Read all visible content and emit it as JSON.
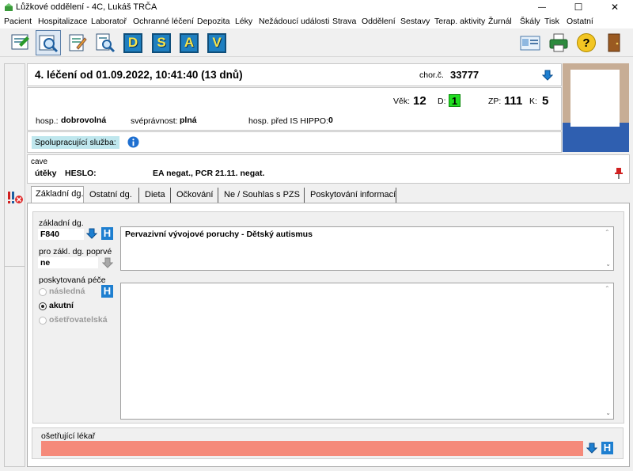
{
  "window": {
    "title": "Lůžkové oddělení - 4C, Lukáš TRČA",
    "minimize": "—",
    "maximize": "☐",
    "close": "✕"
  },
  "menu": [
    "Pacient",
    "Hospitalizace",
    "Laboratoř",
    "Ochranné léčení",
    "Depozita",
    "Léky",
    "Nežádoucí události",
    "Strava",
    "Oddělení",
    "Sestavy",
    "Terap. aktivity",
    "Žurnál",
    "Škály",
    "Tisk",
    "Ostatní"
  ],
  "toolbar": {
    "letters": [
      "D",
      "S",
      "A",
      "V"
    ],
    "help": "?"
  },
  "header": {
    "treatment": "4. léčení od 01.09.2022, 10:41:40 (13 dnů)",
    "chor_label": "chor.č.",
    "chor_value": "33777",
    "vek_label": "Věk:",
    "vek_value": "12",
    "d_label": "D:",
    "d_value": "1",
    "zp_label": "ZP:",
    "zp_value": "111",
    "k_label": "K:",
    "k_value": "5",
    "hosp_label": "hosp.:",
    "hosp_value": "dobrovolná",
    "svepr_label": "svéprávnost:",
    "svepr_value": "plná",
    "hippo_label": "hosp. před IS HIPPO:",
    "hippo_value": "0",
    "sluzba_label": "Spolupracující služba:"
  },
  "cave": {
    "label": "cave",
    "utek": "útěky",
    "heslo": "HESLO:",
    "text": "EA negat., PCR 21.11. negat."
  },
  "tabs": [
    "Základní dg.",
    "Ostatní dg.",
    "Dieta",
    "Očkování",
    "Ne / Souhlas s PZS",
    "Poskytování informací"
  ],
  "form": {
    "zakladni_dg_label": "základní dg.",
    "dg_code": "F840",
    "dg_text": "Pervazivní vývojové poruchy - Dětský autismus",
    "poprve_label": "pro zákl. dg. poprvé",
    "poprve_value": "ne",
    "pece_label": "poskytovaná péče",
    "pece_options": [
      {
        "label": "následná",
        "selected": false,
        "enabled": false
      },
      {
        "label": "akutní",
        "selected": true,
        "enabled": true
      },
      {
        "label": "ošetřovatelská",
        "selected": false,
        "enabled": false
      }
    ],
    "lekar_label": "ošetřující lékař",
    "h_label": "H"
  },
  "colors": {
    "sluzba_bg": "#bfe7ee",
    "d_badge": "#22dd22",
    "lekar_bg": "#f58a7a",
    "accent": "#1e7fc0"
  }
}
